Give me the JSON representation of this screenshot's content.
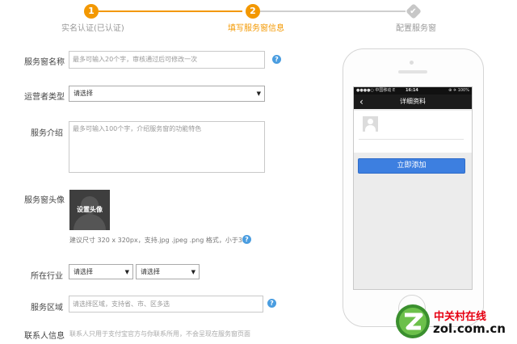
{
  "stepper": {
    "steps": [
      {
        "number": "1",
        "label": "实名认证(已认证)",
        "status": "done"
      },
      {
        "number": "2",
        "label": "填写服务窗信息",
        "status": "current"
      },
      {
        "number": "",
        "label": "配置服务窗",
        "status": "pending"
      }
    ]
  },
  "form": {
    "name": {
      "label": "服务窗名称",
      "placeholder": "最多可输入20个字，审核通过后可修改一次"
    },
    "operator_type": {
      "label": "运营者类型",
      "selected": "请选择"
    },
    "intro": {
      "label": "服务介绍",
      "placeholder": "最多可输入100个字，介绍服务窗的功能特色"
    },
    "avatar": {
      "label": "服务窗头像",
      "button": "设置头像",
      "hint": "建议尺寸 320 x 320px，支持.jpg .jpeg .png 格式，小于3M。"
    },
    "industry": {
      "label": "所在行业",
      "select1": "请选择",
      "select2": "请选择"
    },
    "area": {
      "label": "服务区域",
      "placeholder": "请选择区域，支持省、市、区多选"
    },
    "contact": {
      "label": "联系人信息",
      "hint": "联系人只用于支付宝官方与你联系所用，不会呈现在服务窗页面"
    }
  },
  "phone": {
    "status_left": "●●●●○ 中国移动  E",
    "status_time": "16:14",
    "status_right": "⊕ ✈ 100%",
    "title": "详细资料",
    "button": "立即添加"
  },
  "watermark": {
    "cn": "中关村在线",
    "en": "zol.com.cn"
  },
  "colors": {
    "accent_orange": "#f39800",
    "button_blue": "#3d7fe0",
    "help_blue": "#4a9de0"
  }
}
